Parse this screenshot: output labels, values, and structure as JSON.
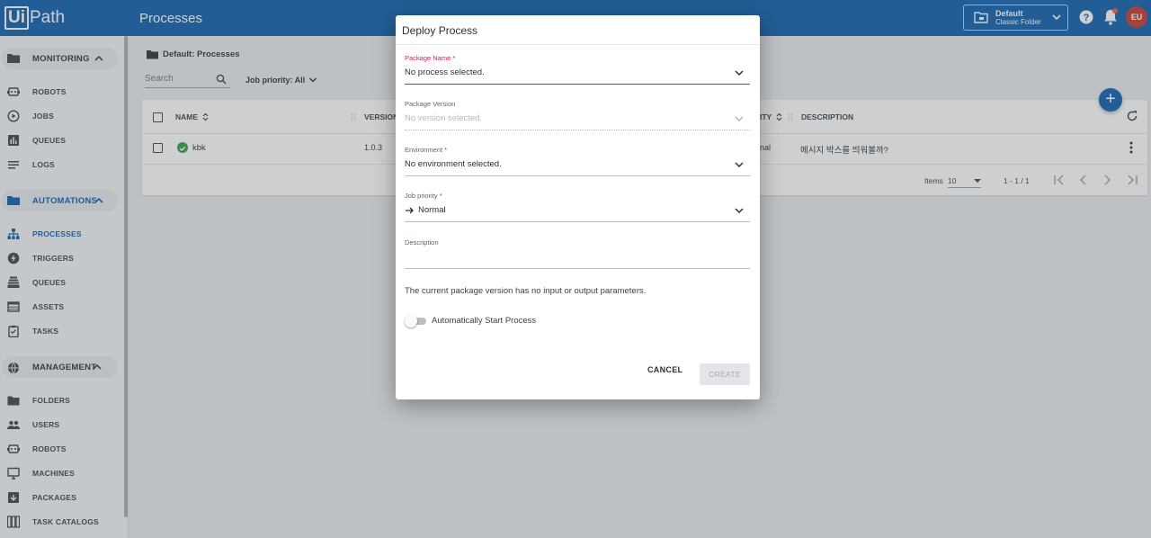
{
  "app": {
    "logo_ui": "Ui",
    "logo_path": "Path",
    "page_title": "Processes"
  },
  "header": {
    "folder_line1": "Default",
    "folder_line2": "Classic Folder",
    "avatar_initials": "EU"
  },
  "sidebar": {
    "groups": [
      {
        "label": "MONITORING",
        "items": [
          "ROBOTS",
          "JOBS",
          "QUEUES",
          "LOGS"
        ]
      },
      {
        "label": "AUTOMATIONS",
        "items": [
          "PROCESSES",
          "TRIGGERS",
          "QUEUES",
          "ASSETS",
          "TASKS"
        ]
      },
      {
        "label": "MANAGEMENT",
        "items": [
          "FOLDERS",
          "USERS",
          "ROBOTS",
          "MACHINES",
          "PACKAGES",
          "TASK CATALOGS"
        ]
      }
    ]
  },
  "main": {
    "breadcrumb": "Default: Processes",
    "search_placeholder": "Search",
    "job_priority_filter": "Job priority: All",
    "table": {
      "columns": {
        "name": "NAME",
        "version": "VERSION",
        "priority": "ITY",
        "description": "DESCRIPTION"
      },
      "row": {
        "name": "kbk",
        "version": "1.0.3",
        "priority": "nal",
        "description": "메시지 박스를 띄워볼까?"
      }
    },
    "pager": {
      "items_label": "Items",
      "items_per_page": "10",
      "range": "1 - 1 / 1"
    }
  },
  "dialog": {
    "title": "Deploy Process",
    "package_name": {
      "label": "Package Name *",
      "value": "No process selected."
    },
    "package_version": {
      "label": "Package Version",
      "value": "No version selected."
    },
    "environment": {
      "label": "Environment *",
      "value": "No environment selected."
    },
    "job_priority": {
      "label": "Job priority *",
      "value": "Normal"
    },
    "description": {
      "label": "Description",
      "value": ""
    },
    "info_text": "The current package version has no input or output parameters.",
    "auto_start_label": "Automatically Start Process",
    "cancel_label": "CANCEL",
    "create_label": "CREATE"
  }
}
